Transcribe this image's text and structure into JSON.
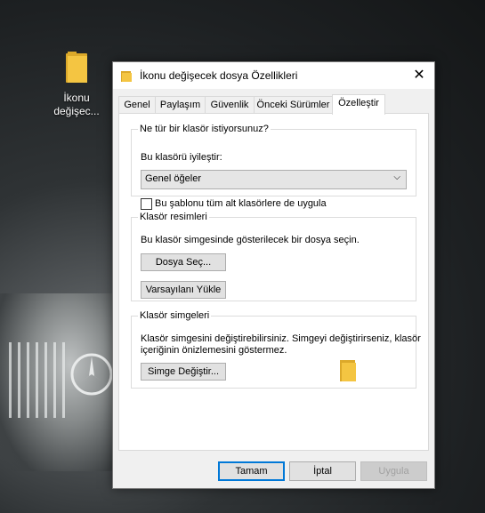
{
  "desktop": {
    "icon_label_line1": "İkonu",
    "icon_label_line2": "değişec..."
  },
  "dialog": {
    "title": "İkonu değişecek dosya Özellikleri",
    "close_glyph": "✕",
    "tabs": [
      "Genel",
      "Paylaşım",
      "Güvenlik",
      "Önceki Sürümler",
      "Özelleştir"
    ],
    "active_tab": "Özelleştir",
    "section1": {
      "legend": "Ne tür bir klasör istiyorsunuz?",
      "optimize_label": "Bu klasörü iyileştir:",
      "optimize_value": "Genel öğeler",
      "checkbox_label": "Bu şablonu tüm alt klasörlere de uygula",
      "checkbox_checked": false
    },
    "section2": {
      "legend": "Klasör resimleri",
      "desc": "Bu klasör simgesinde gösterilecek bir dosya seçin.",
      "choose_file_button": "Dosya Seç...",
      "restore_default_button": "Varsayılanı Yükle"
    },
    "section3": {
      "legend": "Klasör simgeleri",
      "desc_line1": "Klasör simgesini değiştirebilirsiniz. Simgeyi değiştirirseniz, klasör",
      "desc_line2": "içeriğinin önizlemesini göstermez.",
      "change_icon_button": "Simge Değiştir..."
    },
    "footer": {
      "ok": "Tamam",
      "cancel": "İptal",
      "apply": "Uygula"
    }
  },
  "colors": {
    "folder": "#f4c542",
    "folder_dark": "#dca92a",
    "accent": "#0078d7"
  },
  "icons": {
    "folder": "folder-icon",
    "close": "close-icon",
    "chevron": "chevron-down-icon"
  }
}
